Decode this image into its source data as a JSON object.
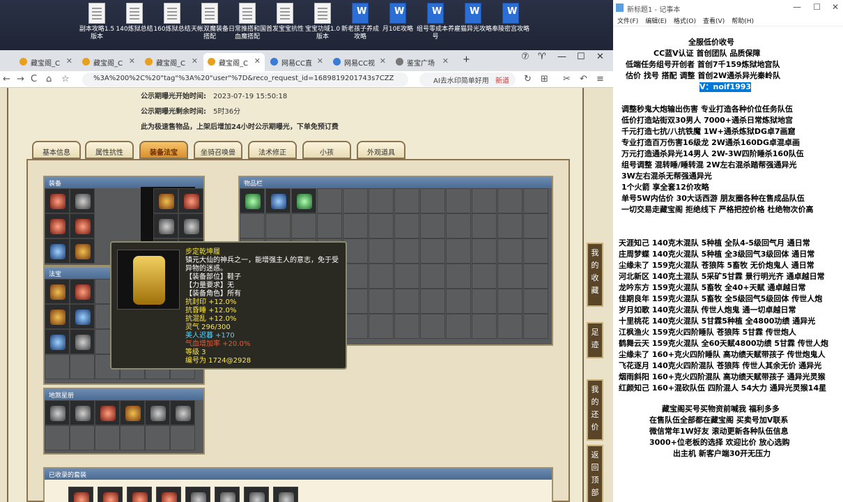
{
  "desktop": {
    "icons": [
      {
        "label": "副本攻略1.5版本",
        "type": "doc"
      },
      {
        "label": "140炼狱总结",
        "type": "doc"
      },
      {
        "label": "160炼狱总结",
        "type": "doc"
      },
      {
        "label": "天帐双魔装备搭配",
        "type": "doc"
      },
      {
        "label": "日常推搭和国血魔搭配",
        "type": "doc"
      },
      {
        "label": "首发宝宝抗性",
        "type": "doc"
      },
      {
        "label": "宝宝功域1.0版本",
        "type": "doc"
      },
      {
        "label": "新老孩子养成攻略",
        "type": "word"
      },
      {
        "label": "月10E攻略",
        "type": "word"
      },
      {
        "label": "组号零成本养号",
        "type": "word"
      },
      {
        "label": "雇猫异光攻略",
        "type": "word"
      },
      {
        "label": "奉陵密宫攻略",
        "type": "word"
      }
    ]
  },
  "browser": {
    "tabs": [
      {
        "label": "藏宝阁_C",
        "fav": "cbg"
      },
      {
        "label": "藏宝阁_C",
        "fav": "cbg"
      },
      {
        "label": "藏宝阁_C",
        "fav": "cbg"
      },
      {
        "label": "藏宝阁_C",
        "fav": "cbg",
        "active": true
      },
      {
        "label": "网易CC直",
        "fav": "cc"
      },
      {
        "label": "网易CC视",
        "fav": "cc"
      },
      {
        "label": "鉴宝广场",
        "fav": "globe"
      }
    ],
    "url": "%3A%200%2C%20\"tag\"%3A%20\"user\"%7D&reco_request_id=1689819201743s7CZZ",
    "search_text": "AI去水印简单好用",
    "search_badge": "新道"
  },
  "listing": {
    "public_start_label": "公示期曝光开始时间:",
    "public_start_value": "2023-07-19 15:50:18",
    "public_remain_label": "公示期曝光剩余时间:",
    "public_remain_value": "5时36分",
    "notice": "此为极速售物品，上架后增加24小时公示期曝光，下单免预订费"
  },
  "tabs": [
    "基本信息",
    "属性抗性",
    "装备法宝",
    "坐骑召唤兽",
    "法术修正",
    "小孩",
    "外观道具"
  ],
  "active_tab": "装备法宝",
  "panels": {
    "equipment": "装备",
    "inventory": "物品栏",
    "treasure": "法宝",
    "earth_treasure": "地煞星册",
    "collected_suits": "已收录的套装"
  },
  "tooltip": {
    "name": "步定乾坤履",
    "desc1": "镇元大仙的神兵之一，能增强主人的意志，免于受",
    "desc2": "异物的迷惑。",
    "slot": "【装备部位】鞋子",
    "power": "【力量要求】无",
    "role": "【装备角色】所有",
    "attr1": "抗封印 +12.0%",
    "attr2": "抗昏睡 +12.0%",
    "attr3": "抗混乱 +12.0%",
    "spirit": "灵气 296/300",
    "beauty": "美人迟暮 +170",
    "qixue": "气血增加率 +20.0%",
    "level": "等级 3",
    "serial": "编号为 1724@2928"
  },
  "side_buttons": [
    "我的收藏",
    "足迹",
    "我的还价",
    "返回顶部"
  ],
  "notepad": {
    "title": "新标题1 - 记事本",
    "menu": [
      "文件(F)",
      "编辑(E)",
      "格式(O)",
      "查看(V)",
      "帮助(H)"
    ],
    "header": [
      "全服低价收号",
      "CC蓝V认证 首创团队 品质保障",
      "低端任务组号开创者          首创7千159炼狱地宫队",
      "估价 找号 搭配 调整          首创2W通杀异光秦岭队"
    ],
    "contact": "V：noif1993",
    "services": [
      "调整秒鬼大炮输出伤害        专业打造各种价位任务队伍",
      "低价打造站街双30男人          7000+通杀日常炼狱地宫",
      "千元打造七抗/八抗铁魔        1W+通杀炼狱DG卓7画窟",
      "专业打造百万伤害16级龙        2W通杀160DG卓混卓画",
      "万元打造通杀异光14男人       2W-3W四阶睡杀160队伍",
      "组号调整 混转睡/睡转混          2W左右混杀踏帮强通异光",
      "                                      3W左右混杀无帮强通异光",
      "1个火箭 享全套12价攻略",
      "单号5W内估价 30大话西游       朋友圈各种在售成品队伍",
      "一切交易走藏宝阁 拒绝线下     严格把控价格 杜绝物次价高"
    ],
    "listings": [
      "天涯知己 140克木混队 5种植 全队4-5级回气月 通日常",
      "庄周梦蝶 140克火混队 5种植 全3级回气3级回体 通日常",
      "尘缘未了 159克火混队 苍狼阵 5畜牧 无价炮鬼人 通日常",
      "河北新区 140克土混队 5采矿5甘霖 景行明光齐 通卓越日常",
      "龙吟东方 159克火混队 5畜牧 全40+天赋 通卓越日常",
      "佳期良年 159克火混队 5畜牧 全5级回气5级回体 传世人炮",
      "岁月如歌 140克火混队 传世人炮鬼 通一切卓越日常",
      "十里桃花 140克火混队 5甘霖5种植 全4800功绩 通异光",
      "江枫渔火 159克火四阶睡队 苍狼阵 5甘霖 传世炮人",
      "鹤舞云天 159克火混队 全60天赋4800功绩 5甘霖 传世人炮",
      "尘缘未了 160+克火四阶睡队 高功绩天赋带孩子 传世炮鬼人",
      "飞花逐月 140克火四阶混队 苍狼阵 传世人其余无价 通异光",
      "烟雨斜阳 160+克火四阶混队 高功绩天赋带孩子 通异光灵猴",
      "红颜知己 160+混砍队伍 四阶混人 54大力 通异光灵猴14星"
    ],
    "footer": [
      "藏宝阁买号买物资前喊我 福利多多",
      "在售队伍全部都在藏宝阁 买卖号加V联系",
      "微信常年1W好友 滚动更新各种队伍信息",
      "3000+位老板的选择 欢迎比价 放心选购",
      "出主机 新客户端30开无压力"
    ]
  }
}
